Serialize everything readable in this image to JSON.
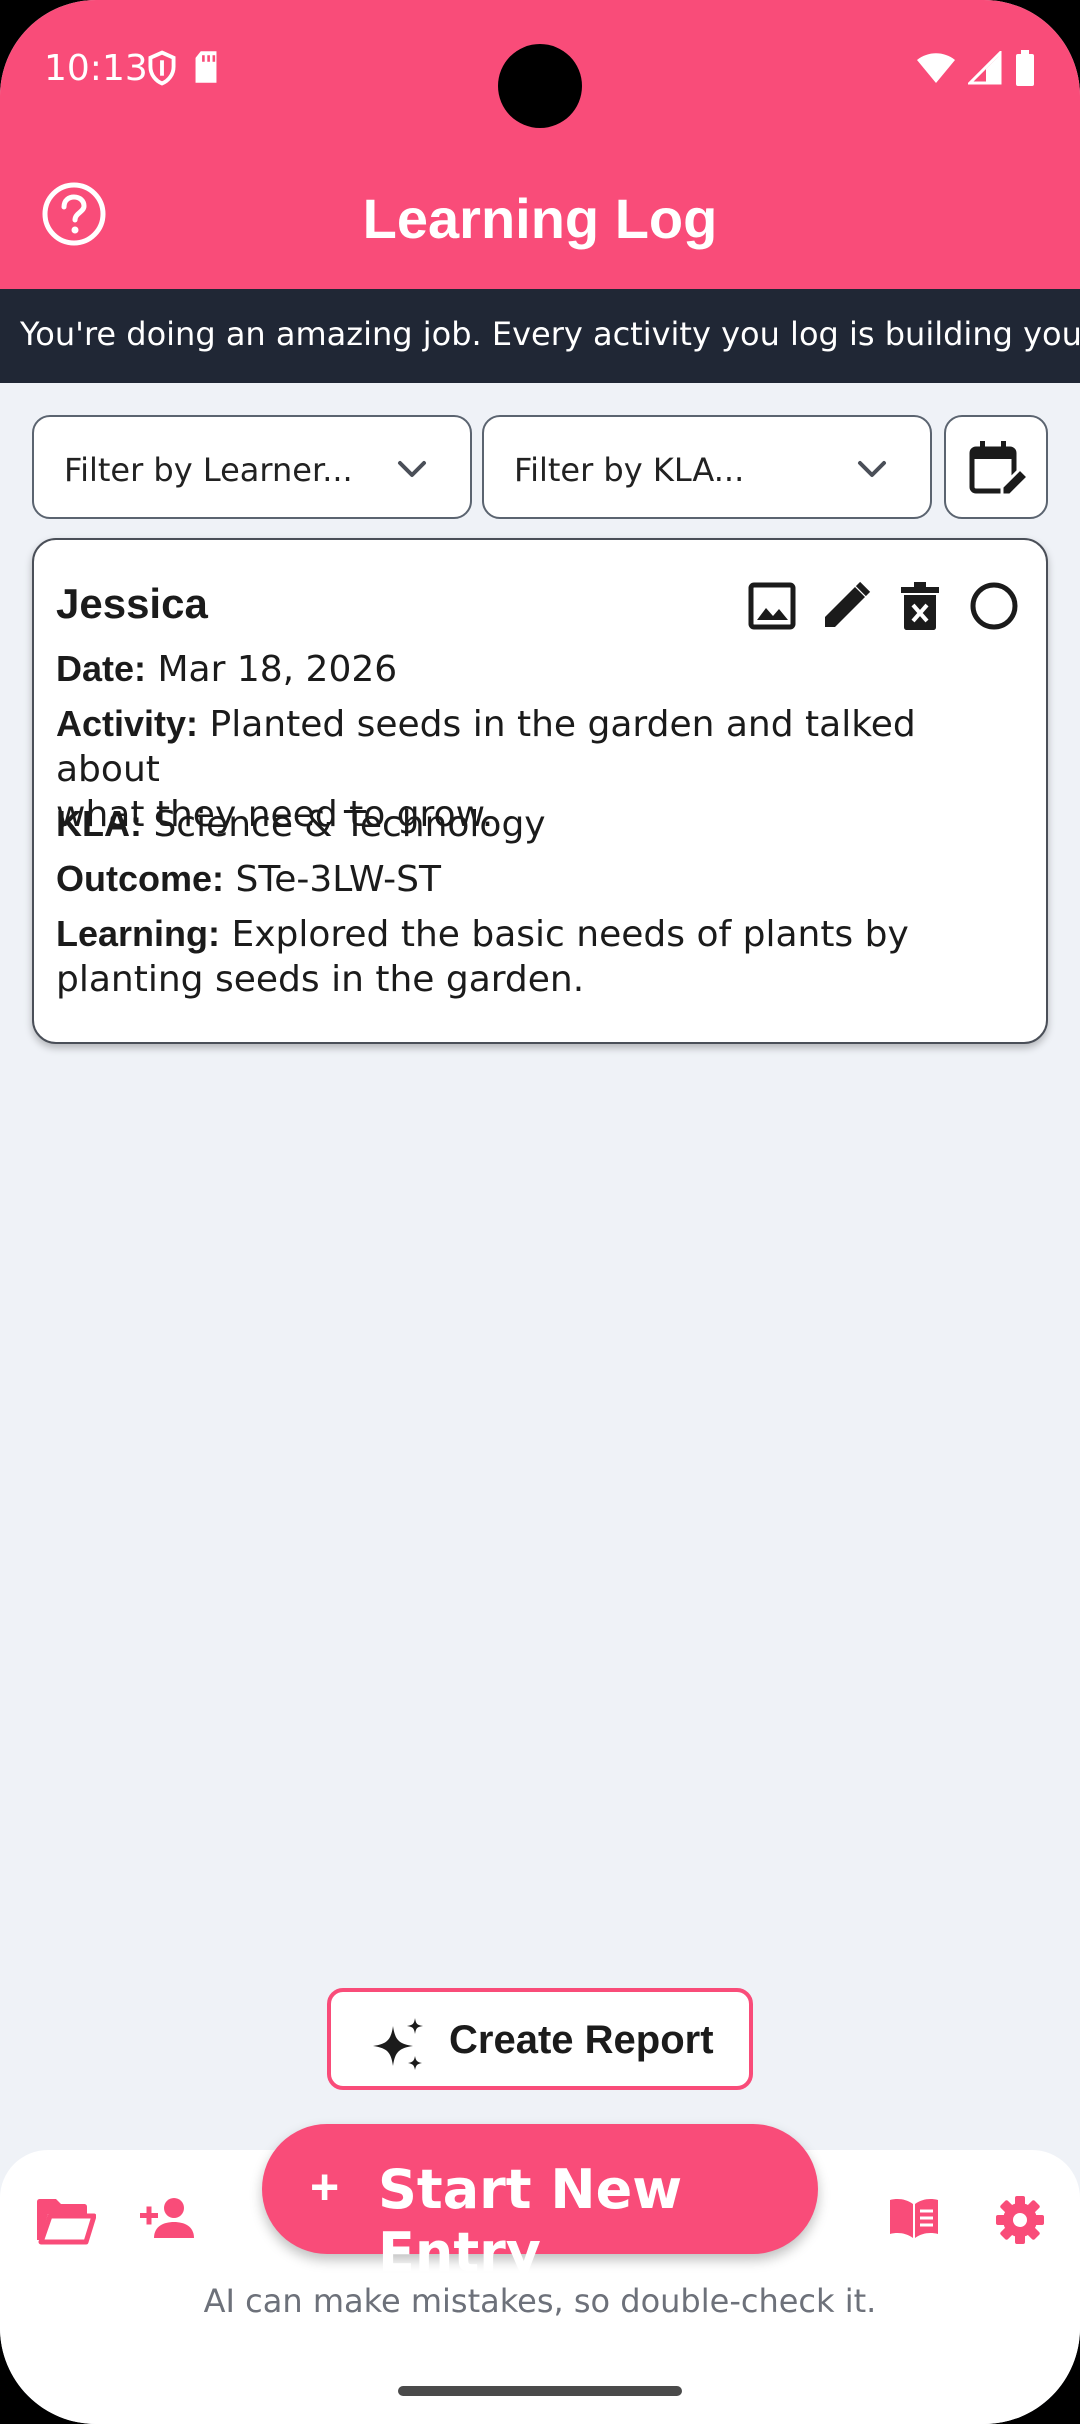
{
  "status_bar": {
    "time": "10:13"
  },
  "header": {
    "title": "Learning Log"
  },
  "ticker": {
    "text": "You're doing an amazing job. Every activity you log is building your chil"
  },
  "filters": {
    "learner_placeholder": "Filter by Learner...",
    "kla_placeholder": "Filter by KLA..."
  },
  "entries": [
    {
      "name": "Jessica",
      "date_label": "Date:",
      "date": "Mar 18, 2026",
      "activity_label": "Activity:",
      "activity_line1": "Planted seeds in the garden and talked about",
      "activity_line2": "what they need to grow.",
      "kla_label": "KLA:",
      "kla": "Science & Technology",
      "outcome_label": "Outcome:",
      "outcome": "STe-3LW-ST",
      "learning_label": "Learning:",
      "learning_line1": "Explored the basic needs of plants by",
      "learning_line2": "planting seeds in the garden."
    }
  ],
  "actions": {
    "create_report": "Create Report",
    "start_new_entry": "Start New Entry",
    "plus": "+"
  },
  "footer": {
    "disclaimer": "AI can make mistakes, so double-check it."
  },
  "colors": {
    "brand": "#f94c79",
    "ticker_bg": "#202735",
    "page_bg": "#eff2f7"
  },
  "icons": {
    "help": "help-circle-icon",
    "calendar": "calendar-edit-icon",
    "image": "image-icon",
    "edit": "pencil-icon",
    "delete": "trash-icon",
    "select": "circle-icon",
    "sparkle": "sparkle-icon",
    "folder": "folder-open-icon",
    "add_person": "person-add-icon",
    "book": "book-open-icon",
    "settings": "gear-icon"
  }
}
